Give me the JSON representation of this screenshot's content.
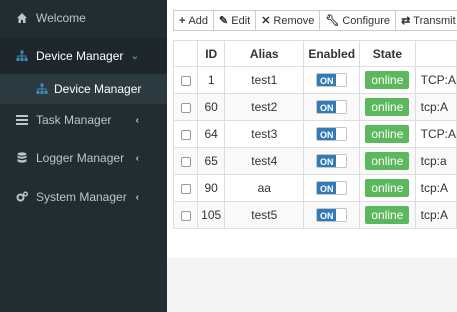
{
  "sidebar": {
    "items": [
      {
        "label": "Welcome",
        "icon": "home-icon",
        "arrow": ""
      },
      {
        "label": "Device Manager",
        "icon": "sitemap-icon",
        "arrow": "⌄"
      },
      {
        "label": "Task Manager",
        "icon": "task-list-icon",
        "arrow": "‹"
      },
      {
        "label": "Logger Manager",
        "icon": "database-icon",
        "arrow": "‹"
      },
      {
        "label": "System Manager",
        "icon": "gears-icon",
        "arrow": "‹"
      }
    ],
    "sub_items": [
      {
        "label": "Device Manager",
        "icon": "sitemap-icon"
      }
    ]
  },
  "toolbar": {
    "add": "Add",
    "edit": "Edit",
    "remove": "Remove",
    "configure": "Configure",
    "transmit": "Transmit"
  },
  "table": {
    "headers": [
      "",
      "ID",
      "Alias",
      "Enabled",
      "State",
      ""
    ],
    "rows": [
      {
        "id": "1",
        "alias": "test1",
        "enabled": "ON",
        "state": "online",
        "conn": "TCP:A"
      },
      {
        "id": "60",
        "alias": "test2",
        "enabled": "ON",
        "state": "online",
        "conn": "tcp:A"
      },
      {
        "id": "64",
        "alias": "test3",
        "enabled": "ON",
        "state": "online",
        "conn": "TCP:A"
      },
      {
        "id": "65",
        "alias": "test4",
        "enabled": "ON",
        "state": "online",
        "conn": "tcp:a"
      },
      {
        "id": "90",
        "alias": "aa",
        "enabled": "ON",
        "state": "online",
        "conn": "tcp:A"
      },
      {
        "id": "105",
        "alias": "test5",
        "enabled": "ON",
        "state": "online",
        "conn": "tcp:A"
      }
    ]
  },
  "colors": {
    "sidebar_bg": "#222d32",
    "active_bg": "#1e282c",
    "accent": "#3c8dbc",
    "toggle_on": "#337ab7",
    "badge_online": "#5cb85c"
  }
}
